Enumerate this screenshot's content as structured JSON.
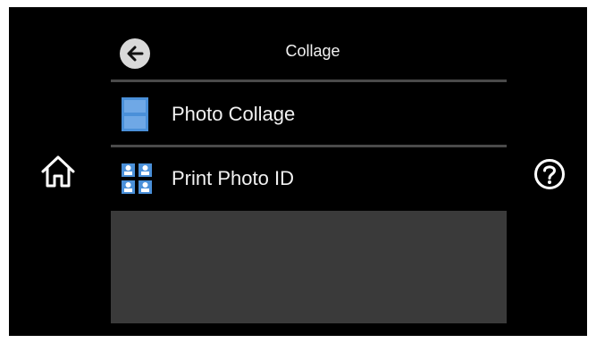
{
  "header": {
    "title": "Collage",
    "back_icon": "back-arrow-icon"
  },
  "menu": {
    "items": [
      {
        "label": "Photo Collage",
        "icon": "photo-collage-icon"
      },
      {
        "label": "Print Photo ID",
        "icon": "photo-id-icon"
      }
    ]
  },
  "nav": {
    "home_icon": "home-icon",
    "help_icon": "help-icon"
  },
  "colors": {
    "background": "#000000",
    "text": "#f2f2f2",
    "icon_blue": "#4a90d9",
    "divider": "#4a4a4a",
    "panel": "#3a3a3a"
  }
}
